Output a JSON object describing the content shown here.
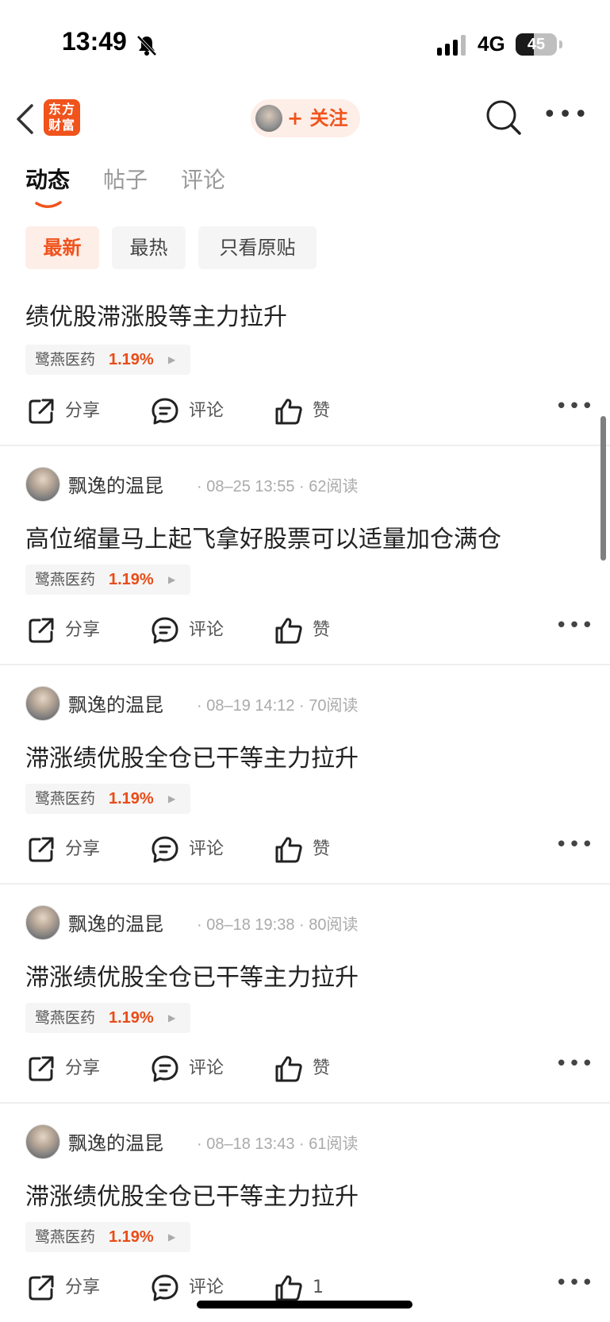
{
  "status_bar": {
    "time": "13:49",
    "network": "4G",
    "battery": "45",
    "battery_level": 0.45
  },
  "nav": {
    "logo_line1": "东方",
    "logo_line2": "财富",
    "follow_label": "+ 关注"
  },
  "tabs": [
    {
      "label": "动态",
      "active": true
    },
    {
      "label": "帖子",
      "active": false
    },
    {
      "label": "评论",
      "active": false
    }
  ],
  "filters": [
    {
      "label": "最新",
      "active": true
    },
    {
      "label": "最热",
      "active": false
    },
    {
      "label": "只看原贴",
      "active": false
    }
  ],
  "accent_color": "#f0531c",
  "posts": [
    {
      "author": "",
      "time": "",
      "reads": "",
      "title": "绩优股滞涨股等主力拉升",
      "stock": {
        "name": "鹭燕医药",
        "change": "1.19%"
      },
      "actions": {
        "share": "分享",
        "comment": "评论",
        "like": "赞"
      }
    },
    {
      "author": "飘逸的温昆",
      "time": "· 08–25 13:55 · 62阅读",
      "title": "高位缩量马上起飞拿好股票可以适量加仓满仓",
      "stock": {
        "name": "鹭燕医药",
        "change": "1.19%"
      },
      "actions": {
        "share": "分享",
        "comment": "评论",
        "like": "赞"
      }
    },
    {
      "author": "飘逸的温昆",
      "time": "· 08–19 14:12 · 70阅读",
      "title": "滞涨绩优股全仓已干等主力拉升",
      "stock": {
        "name": "鹭燕医药",
        "change": "1.19%"
      },
      "actions": {
        "share": "分享",
        "comment": "评论",
        "like": "赞"
      }
    },
    {
      "author": "飘逸的温昆",
      "time": "· 08–18 19:38 · 80阅读",
      "title": "滞涨绩优股全仓已干等主力拉升",
      "stock": {
        "name": "鹭燕医药",
        "change": "1.19%"
      },
      "actions": {
        "share": "分享",
        "comment": "评论",
        "like": "赞"
      }
    },
    {
      "author": "飘逸的温昆",
      "time": "· 08–18 13:43 · 61阅读",
      "title": "滞涨绩优股全仓已干等主力拉升",
      "stock": {
        "name": "鹭燕医药",
        "change": "1.19%"
      },
      "actions": {
        "share": "分享",
        "comment": "评论",
        "like": "1"
      }
    }
  ]
}
